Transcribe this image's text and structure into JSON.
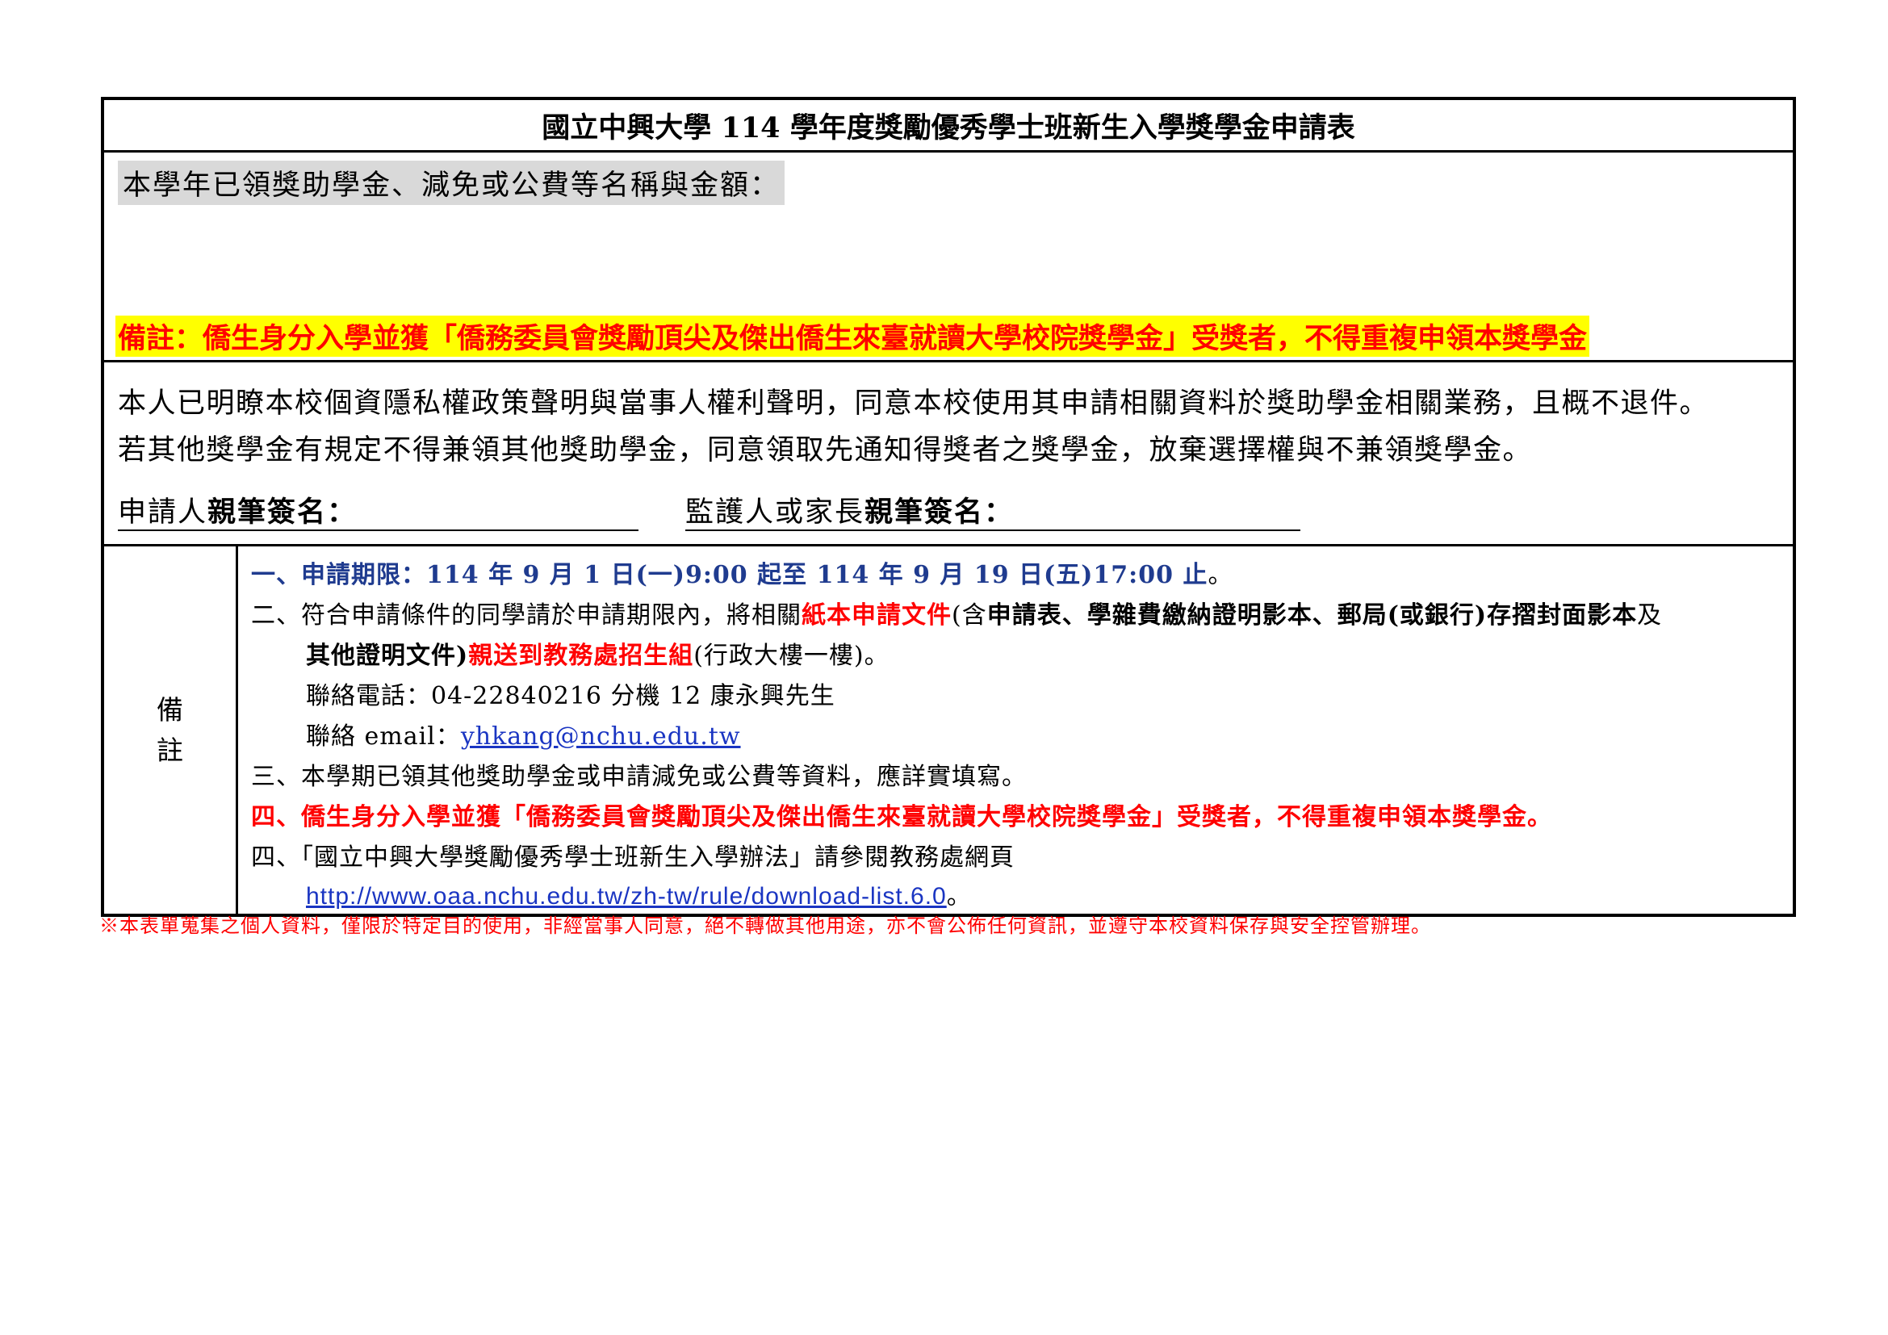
{
  "title": "國立中興大學 114 學年度獎勵優秀學士班新生入學獎學金申請表",
  "awards": {
    "label": "本學年已領獎助學金、減免或公費等名稱與金額：",
    "note": "備註：僑生身分入學並獲「僑務委員會獎勵頂尖及傑出僑生來臺就讀大學校院獎學金」受獎者，不得重複申領本獎學金"
  },
  "consent": {
    "line1": "本人已明瞭本校個資隱私權政策聲明與當事人權利聲明，同意本校使用其申請相關資料於獎助學金相關業務，且概不退件。",
    "line2": "若其他獎學金有規定不得兼領其他獎助學金，同意領取先通知得獎者之獎學金，放棄選擇權與不兼領獎學金。",
    "applicant_prefix": "申請人",
    "applicant_bold": "親筆簽名：",
    "guardian_prefix": "監護人或家長",
    "guardian_bold": "親筆簽名："
  },
  "notes": {
    "label_1": "備",
    "label_2": "註",
    "item1": "一、申請期限：114 年 9 月 1 日(一)9:00 起至 114 年 9 月 19 日(五)17:00 止",
    "item1_end": "。",
    "item2_a": "二、符合申請條件的同學請於申請期限內，將相關",
    "item2_b": "紙本申請文件",
    "item2_c": "(含",
    "item2_d": "申請表、學雜費繳納證明影本、郵局(或銀行)存摺封面影本",
    "item2_e": "及",
    "item2_f": "其他證明文件)",
    "item2_g": "親送到教務處招生組",
    "item2_h": "(行政大樓一樓)。",
    "phone": "聯絡電話：04-22840216 分機 12  康永興先生",
    "email_label": "聯絡 email：",
    "email": "yhkang@nchu.edu.tw",
    "item3": "三、本學期已領其他獎助學金或申請減免或公費等資料，應詳實填寫。",
    "item4": "四、僑生身分入學並獲「僑務委員會獎勵頂尖及傑出僑生來臺就讀大學校院獎學金」受獎者，不得重複申領本獎學金。",
    "item5": "四、「國立中興大學獎勵優秀學士班新生入學辦法」請參閱教務處網頁",
    "url": "http://www.oaa.nchu.edu.tw/zh-tw/rule/download-list.6.0",
    "url_end": "。"
  },
  "privacy": "※本表單蒐集之個人資料，僅限於特定目的使用，非經當事人同意，絕不轉做其他用途，亦不會公佈任何資訊，並遵守本校資料保存與安全控管辦理。",
  "colors": {
    "red": "#ff0000",
    "blue": "#1f3b8f",
    "highlight": "#ffff00",
    "label_gray": "#d9d9d9"
  }
}
